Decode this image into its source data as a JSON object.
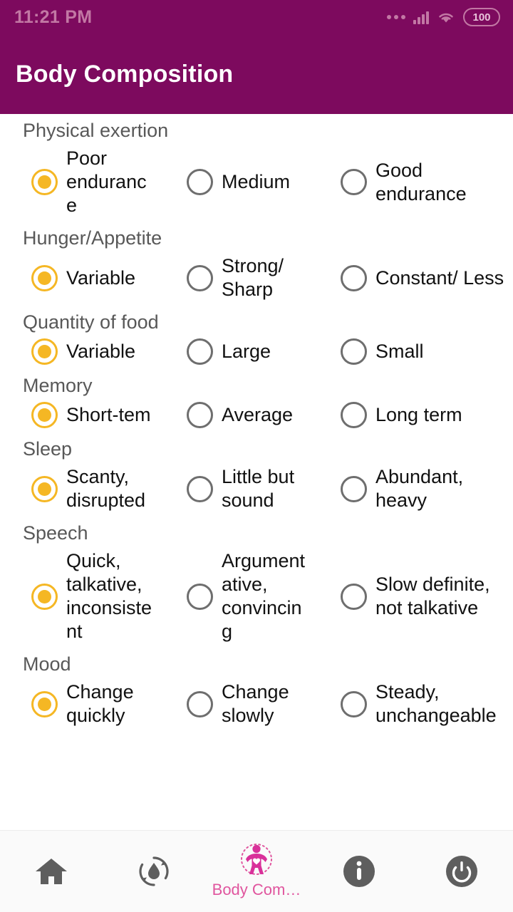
{
  "status_bar": {
    "time": "11:21 PM",
    "battery_level": "100",
    "icons": [
      "more-dots-icon",
      "signal-icon",
      "wifi-icon",
      "battery-icon"
    ],
    "text_color": "#c278a4"
  },
  "app_bar": {
    "title": "Body Composition",
    "background": "#7d0a5e",
    "title_color": "#ffffff"
  },
  "theme": {
    "radio_checked_color": "#f5b724",
    "radio_unchecked_color": "#6e6e6e",
    "section_label_color": "#585858",
    "option_label_color": "#111111",
    "active_nav_color": "#e0559e",
    "nav_icon_color": "#5e5e5e"
  },
  "sections": [
    {
      "label": "Physical exertion",
      "options": [
        {
          "label": "Poor endurance",
          "selected": true
        },
        {
          "label": "Medium",
          "selected": false
        },
        {
          "label": "Good endurance",
          "selected": false
        }
      ]
    },
    {
      "label": "Hunger/Appetite",
      "options": [
        {
          "label": "Variable",
          "selected": true
        },
        {
          "label": "Strong/ Sharp",
          "selected": false
        },
        {
          "label": "Constant/ Less",
          "selected": false
        }
      ]
    },
    {
      "label": "Quantity of food",
      "options": [
        {
          "label": "Variable",
          "selected": true
        },
        {
          "label": "Large",
          "selected": false
        },
        {
          "label": "Small",
          "selected": false
        }
      ]
    },
    {
      "label": "Memory",
      "options": [
        {
          "label": "Short-tem",
          "selected": true
        },
        {
          "label": "Average",
          "selected": false
        },
        {
          "label": "Long term",
          "selected": false
        }
      ]
    },
    {
      "label": "Sleep",
      "options": [
        {
          "label": "Scanty, disrupted",
          "selected": true
        },
        {
          "label": "Little but sound",
          "selected": false
        },
        {
          "label": "Abundant, heavy",
          "selected": false
        }
      ]
    },
    {
      "label": "Speech",
      "options": [
        {
          "label": "Quick, talkative, inconsistent",
          "selected": true
        },
        {
          "label": "Argumentative, convincing",
          "selected": false
        },
        {
          "label": "Slow definite, not talkative",
          "selected": false
        }
      ]
    },
    {
      "label": "Mood",
      "options": [
        {
          "label": "Change quickly",
          "selected": true
        },
        {
          "label": "Change slowly",
          "selected": false
        },
        {
          "label": "Steady, unchangeable",
          "selected": false
        }
      ]
    }
  ],
  "bottom_nav": {
    "items": [
      {
        "icon": "home-icon",
        "label": "",
        "active": false
      },
      {
        "icon": "water-cycle-icon",
        "label": "",
        "active": false
      },
      {
        "icon": "body-composition-icon",
        "label": "Body Com…",
        "active": true
      },
      {
        "icon": "info-icon",
        "label": "",
        "active": false
      },
      {
        "icon": "power-icon",
        "label": "",
        "active": false
      }
    ]
  }
}
